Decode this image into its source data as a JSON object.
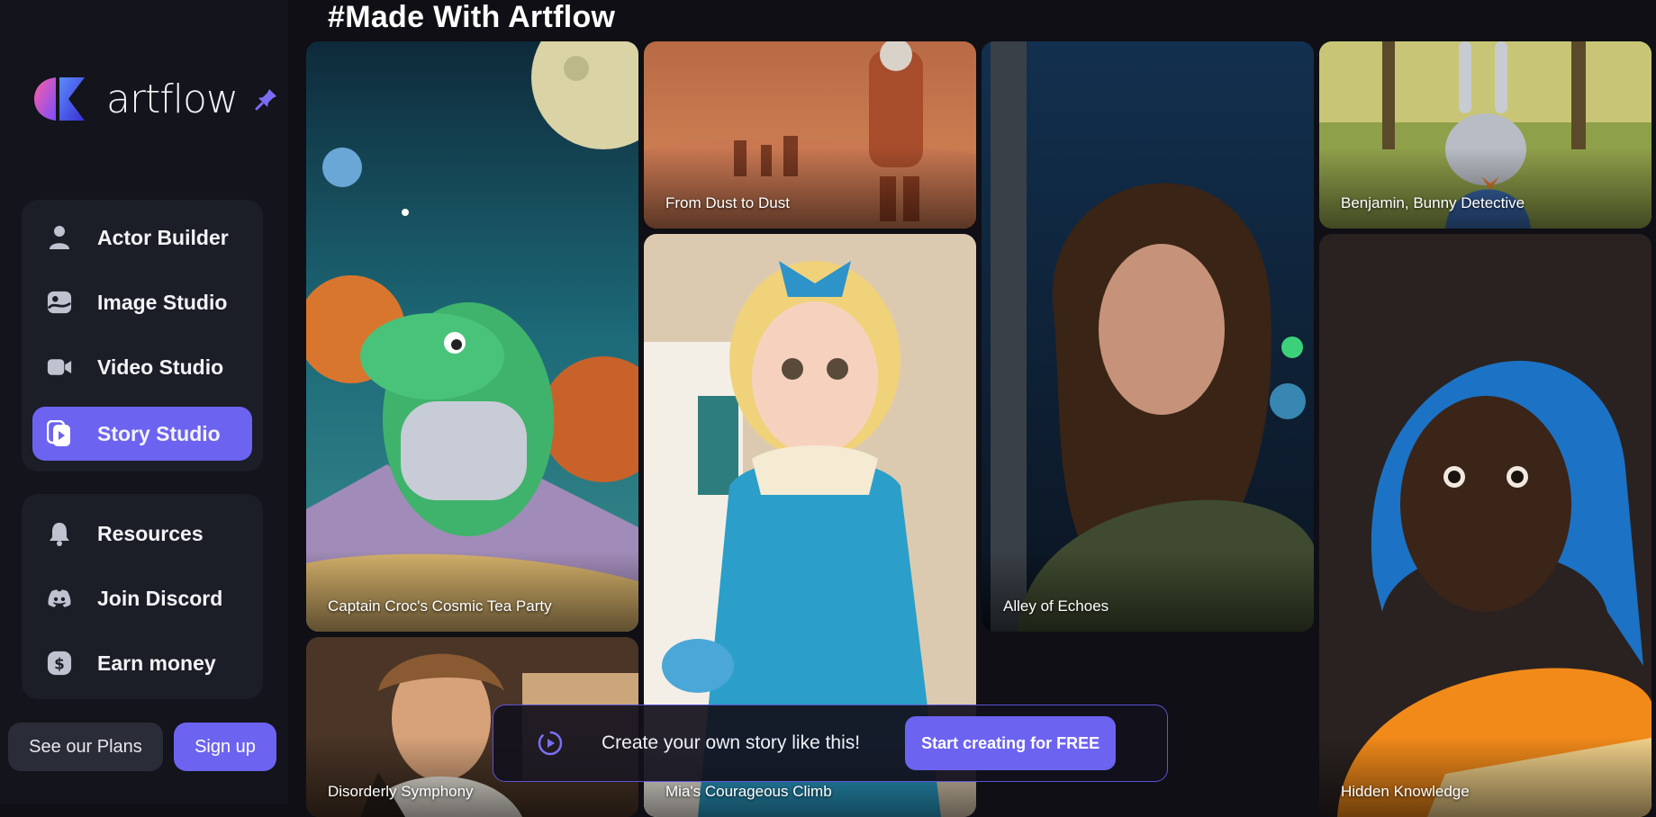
{
  "brand": {
    "name": "artflow",
    "accent": "#6c63f0"
  },
  "sidebar": {
    "main_items": [
      {
        "label": "Actor Builder",
        "icon": "person-icon"
      },
      {
        "label": "Image Studio",
        "icon": "image-icon"
      },
      {
        "label": "Video Studio",
        "icon": "video-camera-icon"
      },
      {
        "label": "Story Studio",
        "icon": "story-icon",
        "active": true
      }
    ],
    "secondary_items": [
      {
        "label": "Resources",
        "icon": "bell-icon"
      },
      {
        "label": "Join Discord",
        "icon": "discord-icon"
      },
      {
        "label": "Earn money",
        "icon": "dollar-icon"
      }
    ],
    "plans_button": "See our Plans",
    "signup_button": "Sign up"
  },
  "main": {
    "heading": "#Made With Artflow",
    "cards": [
      {
        "title": "Captain Croc's Cosmic Tea Party"
      },
      {
        "title": "Disorderly Symphony"
      },
      {
        "title": "From Dust to Dust"
      },
      {
        "title": "Mia's Courageous Climb"
      },
      {
        "title": "Alley of Echoes"
      },
      {
        "title": "Benjamin, Bunny Detective"
      },
      {
        "title": "Hidden Knowledge"
      }
    ]
  },
  "cta": {
    "text": "Create your own story like this!",
    "button": "Start creating for FREE"
  }
}
